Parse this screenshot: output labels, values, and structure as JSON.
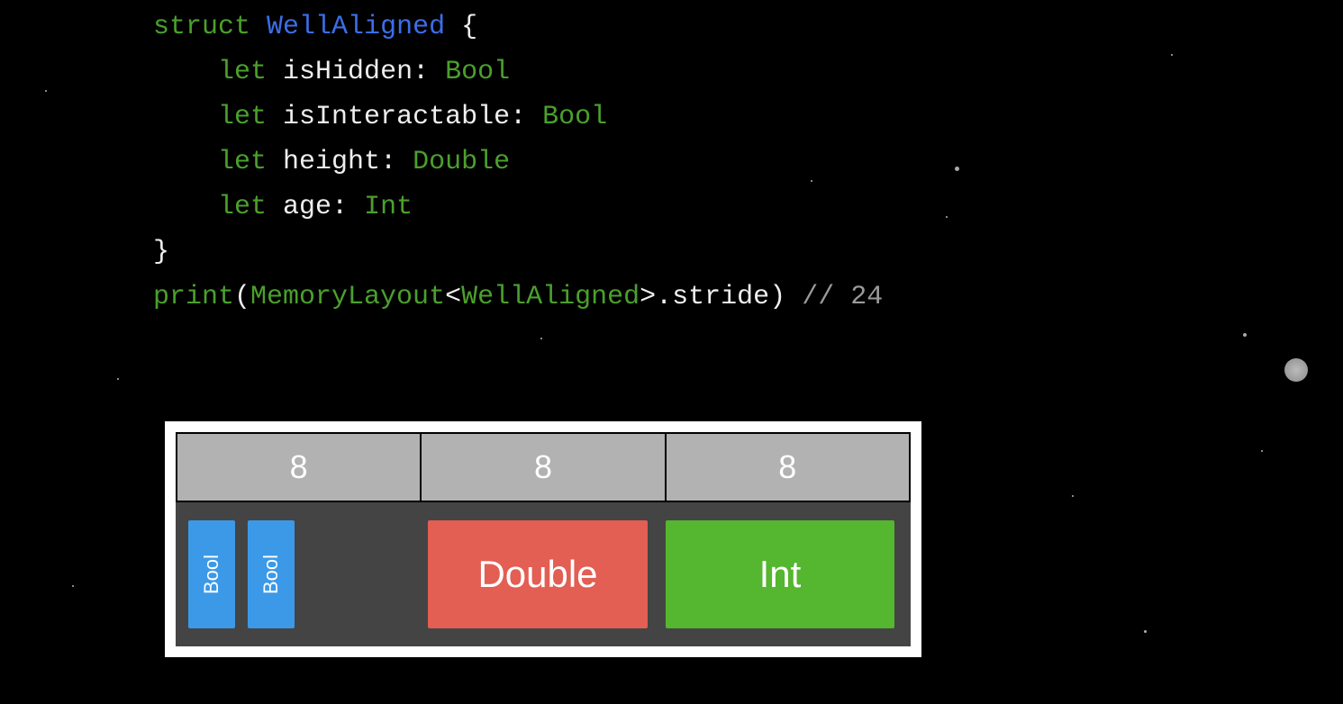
{
  "code": {
    "struct_kw": "struct",
    "struct_name": "WellAligned",
    "open": " {",
    "let": "let",
    "fields": [
      {
        "name": "isHidden",
        "type": "Bool"
      },
      {
        "name": "isInteractable",
        "type": "Bool"
      },
      {
        "name": "height",
        "type": "Double"
      },
      {
        "name": "age",
        "type": "Int"
      }
    ],
    "close": "}",
    "print_fn": "print",
    "lparen": "(",
    "memlayout": "MemoryLayout",
    "lt": "<",
    "gt": ">",
    "stride": ".stride",
    "rparen": ")",
    "comment": " // 24"
  },
  "diagram": {
    "ruler": [
      "8",
      "8",
      "8"
    ],
    "blocks": {
      "bool1": "Bool",
      "bool2": "Bool",
      "double": "Double",
      "int": "Int"
    }
  }
}
